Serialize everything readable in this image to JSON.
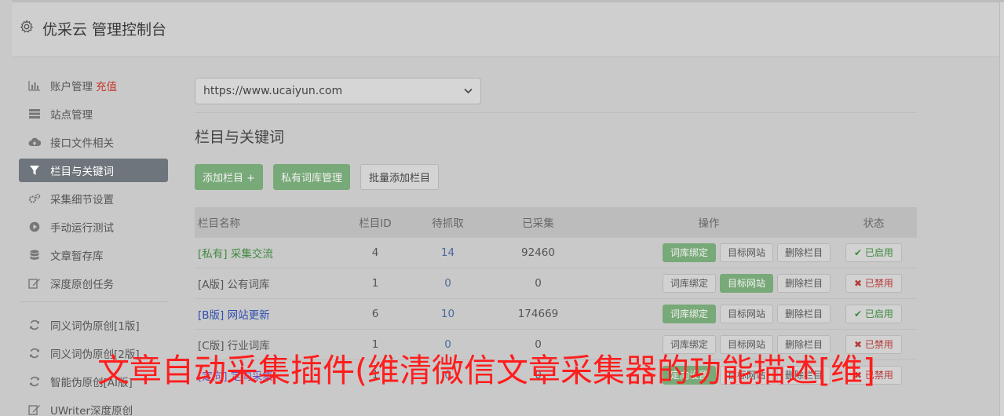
{
  "header": {
    "title": "优采云 管理控制台",
    "icon": "gear-icon"
  },
  "sidebar": {
    "items": [
      {
        "label": "账户管理",
        "extra": "充值",
        "icon": "bar-chart-icon",
        "active": false
      },
      {
        "label": "站点管理",
        "icon": "server-icon",
        "active": false
      },
      {
        "label": "接口文件相关",
        "icon": "cloud-upload-icon",
        "active": false
      },
      {
        "label": "栏目与关键词",
        "icon": "filter-icon",
        "active": true
      },
      {
        "label": "采集细节设置",
        "icon": "cogs-icon",
        "active": false
      },
      {
        "label": "手动运行测试",
        "icon": "play-circle-icon",
        "active": false
      },
      {
        "label": "文章暂存库",
        "icon": "database-icon",
        "active": false
      },
      {
        "label": "深度原创任务",
        "icon": "edit-icon",
        "active": false
      }
    ],
    "items2": [
      {
        "label": "同义词伪原创[1版]",
        "icon": "refresh-icon"
      },
      {
        "label": "同义词伪原创[2版]",
        "icon": "refresh-icon"
      },
      {
        "label": "智能伪原创[AI版]",
        "icon": "refresh-icon"
      },
      {
        "label": "UWriter深度原创",
        "icon": "edit-icon"
      }
    ]
  },
  "main": {
    "site_select": "https://www.ucaiyun.com",
    "section_title": "栏目与关键词",
    "buttons": {
      "add": "添加栏目 +",
      "private_lib": "私有词库管理",
      "batch_add": "批量添加栏目"
    },
    "table": {
      "headers": {
        "name": "栏目名称",
        "id": "栏目ID",
        "pending": "待抓取",
        "collected": "已采集",
        "ops": "操作",
        "status": "状态"
      },
      "rows": [
        {
          "name": "[私有] 采集交流",
          "id": "4",
          "pending": "14",
          "collected": "92460",
          "ops": [
            "词库绑定",
            "目标网站",
            "删除栏目"
          ],
          "ops_green": [
            0
          ],
          "status": "已启用",
          "status_on": true,
          "name_color": "green"
        },
        {
          "name": "[A版] 公有词库",
          "id": "1",
          "pending": "0",
          "collected": "0",
          "ops": [
            "词库绑定",
            "目标网站",
            "删除栏目"
          ],
          "ops_green": [
            1
          ],
          "status": "已禁用",
          "status_on": false,
          "name_color": "plain"
        },
        {
          "name": "[B版] 网站更新",
          "id": "6",
          "pending": "10",
          "collected": "174669",
          "ops": [
            "词库绑定",
            "目标网站",
            "删除栏目"
          ],
          "ops_green": [
            0
          ],
          "status": "已启用",
          "status_on": true,
          "name_color": "blue"
        },
        {
          "name": "[C版] 行业词库",
          "id": "1",
          "pending": "0",
          "collected": "0",
          "ops": [
            "词库绑定",
            "目标网站",
            "删除栏目"
          ],
          "ops_green": [],
          "status": "已禁用",
          "status_on": false,
          "name_color": "plain"
        },
        {
          "name": "[定向] 定向采集",
          "id": "1",
          "pending": "0",
          "collected": "0",
          "ops": [
            "定向设置",
            "目标网站",
            "删除栏目"
          ],
          "ops_green": [
            0
          ],
          "status": "已禁用",
          "status_on": false,
          "name_color": "purple"
        }
      ]
    }
  },
  "overlay_text": "文章自动采集插件(维清微信文章采集器的功能描述[维]",
  "colors": {
    "active_nav": "#6e757c",
    "green_button": "#78a978",
    "overlay_red": "#ff1d1d"
  }
}
